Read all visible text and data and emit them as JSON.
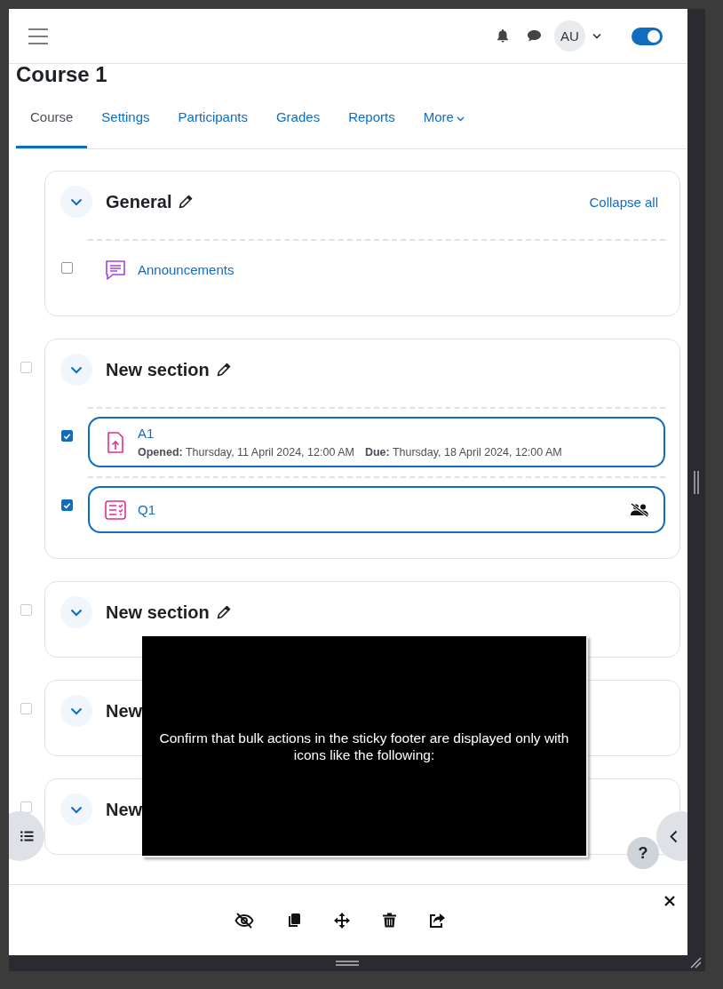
{
  "header": {
    "user_initials": "AU",
    "edit_mode": {
      "on": true
    }
  },
  "course_title": "Course 1",
  "tabs": [
    {
      "label": "Course",
      "selected": true,
      "kind": "link"
    },
    {
      "label": "Settings",
      "selected": false,
      "kind": "link"
    },
    {
      "label": "Participants",
      "selected": false,
      "kind": "link"
    },
    {
      "label": "Grades",
      "selected": false,
      "kind": "link"
    },
    {
      "label": "Reports",
      "selected": false,
      "kind": "link"
    },
    {
      "label": "More",
      "selected": false,
      "kind": "dropdown"
    }
  ],
  "sections": [
    {
      "title": "General",
      "expanded": true,
      "edit_icon": true,
      "collapse_link": "Collapse all",
      "activities": [
        {
          "kind": "forum",
          "name": "Announcements",
          "selected": false
        }
      ]
    },
    {
      "title": "New section",
      "checked": false,
      "expanded": true,
      "edit_icon": true,
      "activities": [
        {
          "kind": "assignment",
          "name": "A1",
          "selected": true,
          "dates": [
            {
              "label": "Opened:",
              "value": "Thursday, 11 April 2024, 12:00 AM"
            },
            {
              "label": "Due:",
              "value": "Thursday, 18 April 2024, 12:00 AM"
            }
          ]
        },
        {
          "kind": "quiz",
          "name": "Q1",
          "selected": true,
          "group_mode": true
        }
      ]
    },
    {
      "title": "New section",
      "checked": false,
      "expanded": true,
      "edit_icon": true
    },
    {
      "title": "New",
      "checked": false,
      "expanded": true
    },
    {
      "title": "New",
      "checked": false,
      "expanded": true
    }
  ],
  "overlay": {
    "text": "Confirm that bulk actions in the sticky footer are displayed only with icons like the following:"
  },
  "help_button": {
    "label": "?"
  }
}
